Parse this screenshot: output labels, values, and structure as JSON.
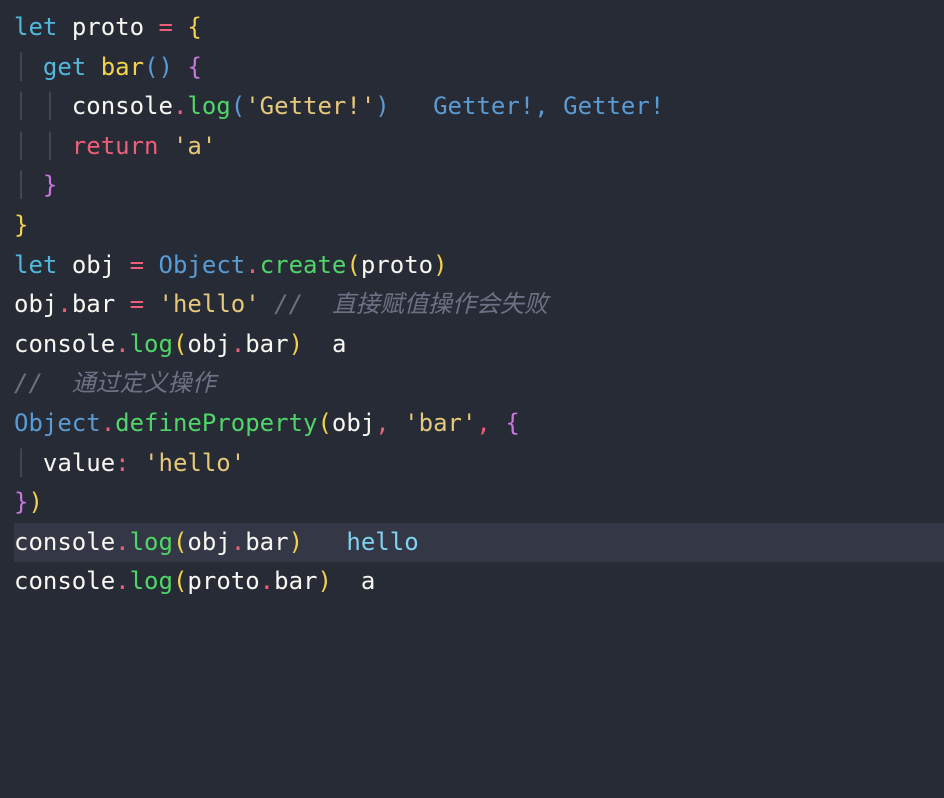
{
  "tokens": {
    "let": "let",
    "get": "get",
    "return": "return",
    "proto": "proto",
    "obj": "obj",
    "console": "console",
    "log": "log",
    "bar": "bar",
    "create": "create",
    "Object": "Object",
    "defineProperty": "defineProperty",
    "value": "value",
    "eq": " = ",
    "dot": ".",
    "colon": ":",
    "comma": ",",
    "slashslash": "//",
    "lbrace": "{",
    "rbrace": "}",
    "lparen": "(",
    "rparen": "()"
  },
  "strings": {
    "getter": "'Getter!'",
    "a": "'a'",
    "hello": "'hello'",
    "barq": "'bar'"
  },
  "outputs": {
    "getterPair": "Getter!, Getter!",
    "a": "a",
    "hello": "hello"
  },
  "comments": {
    "assignFail": " 直接赋值操作会失败",
    "defineOp": " 通过定义操作"
  }
}
